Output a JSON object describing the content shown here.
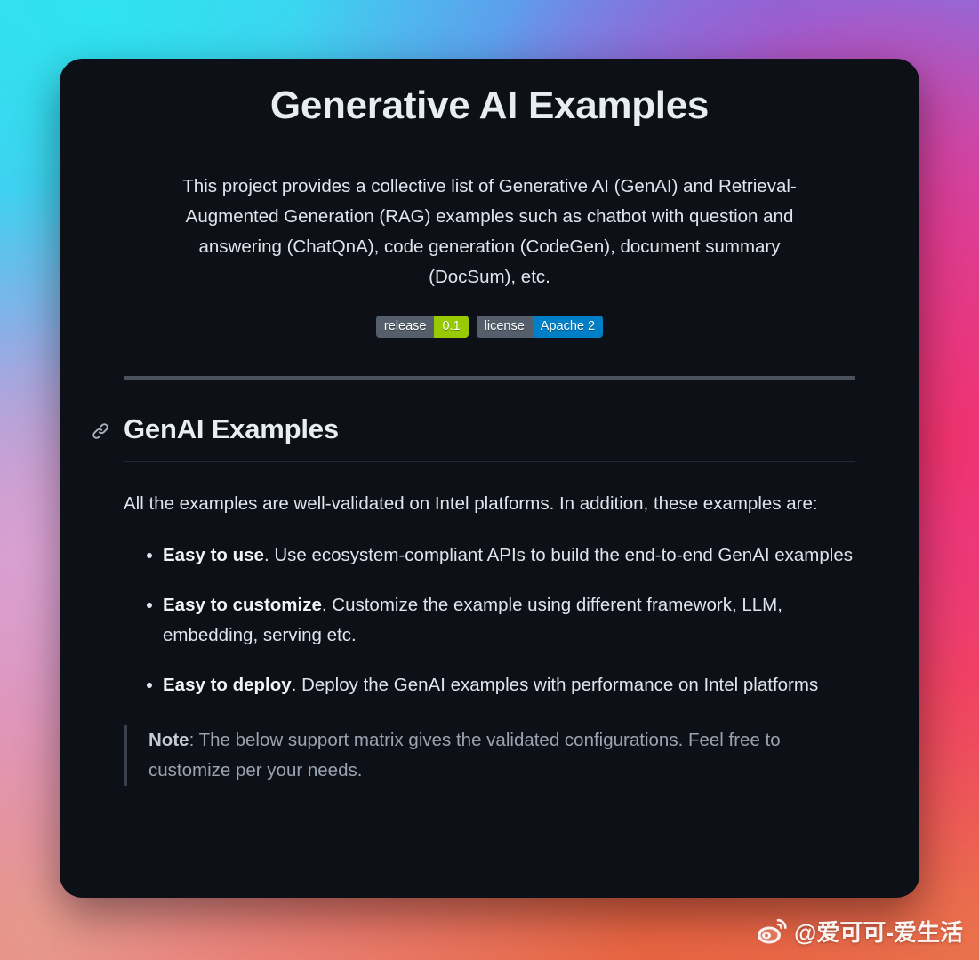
{
  "card": {
    "title": "Generative AI Examples",
    "intro": "This project provides a collective list of Generative AI (GenAI) and Retrieval-Augmented Generation (RAG) examples such as chatbot with question and answering (ChatQnA), code generation (CodeGen), document summary (DocSum), etc.",
    "badges": [
      {
        "label": "release",
        "value": "0.1",
        "value_color": "#97ca00",
        "label_color": "#555f6b"
      },
      {
        "label": "license",
        "value": "Apache 2",
        "value_color": "#007ec6",
        "label_color": "#555f6b"
      }
    ],
    "section": {
      "anchor_icon": "link-icon",
      "heading": "GenAI Examples",
      "lead": "All the examples are well-validated on Intel platforms. In addition, these examples are:",
      "features": [
        {
          "term": "Easy to use",
          "description": ". Use ecosystem-compliant APIs to build the end-to-end GenAI examples"
        },
        {
          "term": "Easy to customize",
          "description": ". Customize the example using different framework, LLM, embedding, serving etc."
        },
        {
          "term": "Easy to deploy",
          "description": ". Deploy the GenAI examples with performance on Intel platforms"
        }
      ],
      "note": {
        "label": "Note",
        "text": ": The below support matrix gives the validated configurations. Feel free to customize per your needs."
      }
    }
  },
  "watermark": {
    "icon": "weibo-logo-icon",
    "handle": "@爱可可-爱生活"
  }
}
